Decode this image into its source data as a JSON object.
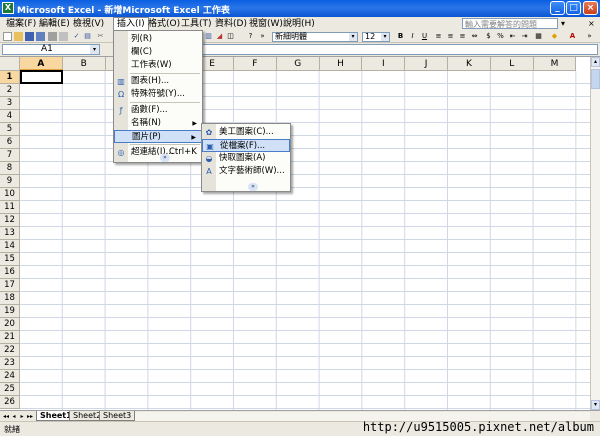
{
  "window": {
    "title": "Microsoft Excel - 新增Microsoft Excel 工作表",
    "controls": {
      "minimize": "_",
      "maximize": "□",
      "close": "×"
    }
  },
  "menubar": {
    "items": [
      "檔案(F)",
      "編輯(E)",
      "檢視(V)",
      "插入(I)",
      "格式(O)",
      "工具(T)",
      "資料(D)",
      "視窗(W)",
      "說明(H)"
    ],
    "active_item": "插入(I)",
    "help_placeholder": "輸入需要解答的問題",
    "doc_controls": {
      "close": "×",
      "dropdown": "▾"
    }
  },
  "toolbar": {
    "font_name": "新細明體",
    "font_size": "12",
    "bold": "B",
    "italic": "I",
    "underline": "U",
    "font_color_icon": "A"
  },
  "formula_bar": {
    "name_box": "A1",
    "formula_icon": "fx"
  },
  "grid": {
    "columns": [
      "A",
      "B",
      "C",
      "D",
      "E",
      "F",
      "G",
      "H",
      "I",
      "J",
      "K",
      "L",
      "M"
    ],
    "rows": [
      "1",
      "2",
      "3",
      "4",
      "5",
      "6",
      "7",
      "8",
      "9",
      "10",
      "11",
      "12",
      "13",
      "14",
      "15",
      "16",
      "17",
      "18",
      "19",
      "20",
      "21",
      "22",
      "23",
      "24",
      "25",
      "26"
    ],
    "selected_column": "A",
    "selected_row": "1",
    "active_cell": "A1"
  },
  "insert_menu": {
    "items": [
      {
        "label": "列(R)",
        "icon": ""
      },
      {
        "label": "欄(C)",
        "icon": ""
      },
      {
        "label": "工作表(W)",
        "icon": ""
      },
      {
        "label": "圖表(H)...",
        "icon": "chart-icon"
      },
      {
        "label": "特殊符號(Y)...",
        "icon": "symbol-icon"
      },
      {
        "label": "函數(F)...",
        "icon": "function-icon"
      },
      {
        "label": "名稱(N)",
        "icon": "",
        "submenu": true
      },
      {
        "label": "圖片(P)",
        "icon": "",
        "submenu": true,
        "highlighted": true
      },
      {
        "label": "超連結(I)...",
        "icon": "hyperlink-icon",
        "shortcut": "Ctrl+K"
      }
    ],
    "expand_label": "»"
  },
  "picture_submenu": {
    "items": [
      {
        "label": "美工圖案(C)...",
        "icon": "clipart-icon"
      },
      {
        "label": "從檔案(F)...",
        "icon": "from-file-icon",
        "highlighted": true
      },
      {
        "label": "快取圖案(A)",
        "icon": "autoshapes-icon"
      },
      {
        "label": "文字藝術師(W)...",
        "icon": "wordart-icon"
      }
    ],
    "expand_label": "»"
  },
  "sheet_tabs": {
    "tabs": [
      "Sheet1",
      "Sheet2",
      "Sheet3"
    ],
    "active": "Sheet1",
    "nav": [
      "◂◂",
      "◂",
      "▸",
      "▸▸"
    ]
  },
  "status_bar": {
    "status": "就緒",
    "watermark": "http://u9515005.pixnet.net/album"
  },
  "colors": {
    "title_bar": "#0a5fe2",
    "menu_bg": "#ebe9e0",
    "highlight": "#cfe0f7",
    "selected_header": "#f8d8a0"
  }
}
